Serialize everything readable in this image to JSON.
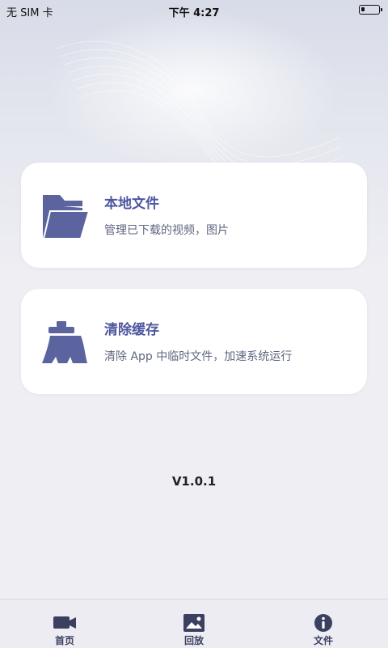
{
  "status_bar": {
    "carrier": "无 SIM 卡",
    "time": "下午 4:27"
  },
  "cards": [
    {
      "title": "本地文件",
      "description": "管理已下载的视频，图片",
      "icon": "folder-icon"
    },
    {
      "title": "清除缓存",
      "description": "清除 App 中临时文件，加速系统运行",
      "icon": "broom-icon"
    }
  ],
  "version": "V1.0.1",
  "tabbar": {
    "items": [
      {
        "label": "首页",
        "icon": "camera-icon"
      },
      {
        "label": "回放",
        "icon": "image-icon"
      },
      {
        "label": "文件",
        "icon": "info-icon"
      }
    ],
    "active_index": 2
  },
  "colors": {
    "accent": "#4e57a0",
    "icon": "#5b649f",
    "background": "#eeeef3",
    "card": "#ffffff"
  }
}
